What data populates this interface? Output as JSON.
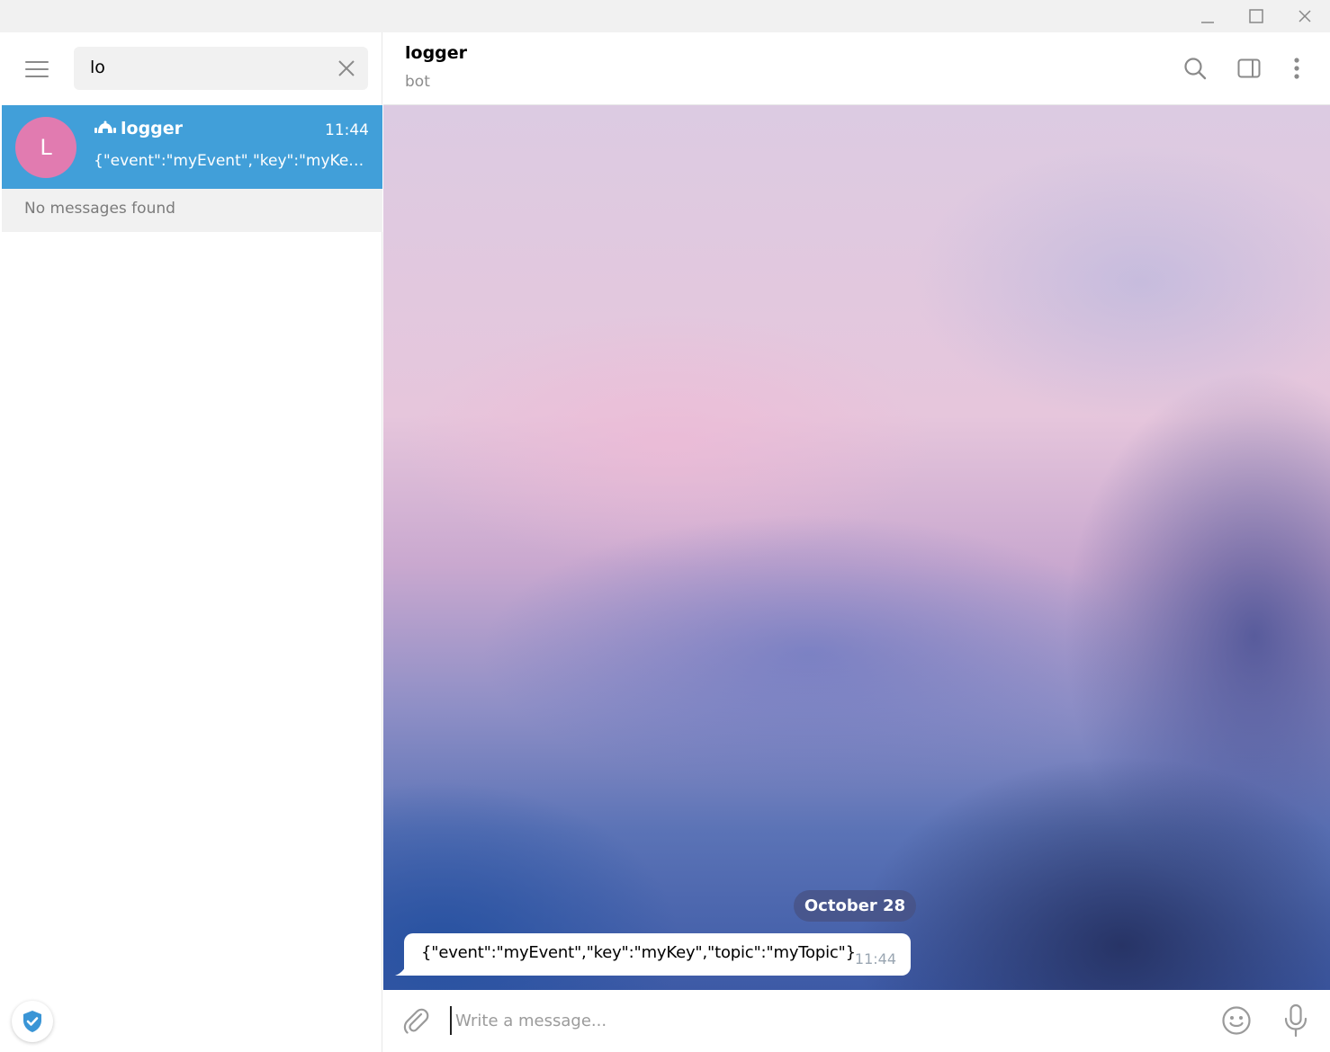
{
  "window": {
    "controls": [
      "minimize-icon",
      "maximize-icon",
      "close-icon"
    ]
  },
  "sidebar": {
    "menu_icon": "hamburger-icon",
    "search": {
      "value": "lo",
      "clear_icon": "close-icon"
    },
    "results": [
      {
        "avatar_letter": "L",
        "avatar_color": "#e17bb0",
        "is_bot": true,
        "name": "logger",
        "time": "11:44",
        "preview": "{\"event\":\"myEvent\",\"key\":\"myKey\",\"topic\":\"myTopic\"}",
        "selected": true
      }
    ],
    "messages_status": "No messages found",
    "bottom_icon": "shield-check-icon"
  },
  "chat": {
    "title": "logger",
    "subtitle": "bot",
    "header_icons": [
      "search-icon",
      "sidebar-toggle-icon",
      "more-vertical-icon"
    ],
    "date_divider": "October 28",
    "messages": [
      {
        "text": "{\"event\":\"myEvent\",\"key\":\"myKey\",\"topic\":\"myTopic\"}",
        "time": "11:44"
      }
    ],
    "composer": {
      "placeholder": "Write a message...",
      "icons": [
        "paperclip-icon",
        "emoji-icon",
        "microphone-icon"
      ]
    }
  },
  "colors": {
    "accent": "#419fd9",
    "avatar": "#e17bb0",
    "date_pill": "#485284"
  }
}
